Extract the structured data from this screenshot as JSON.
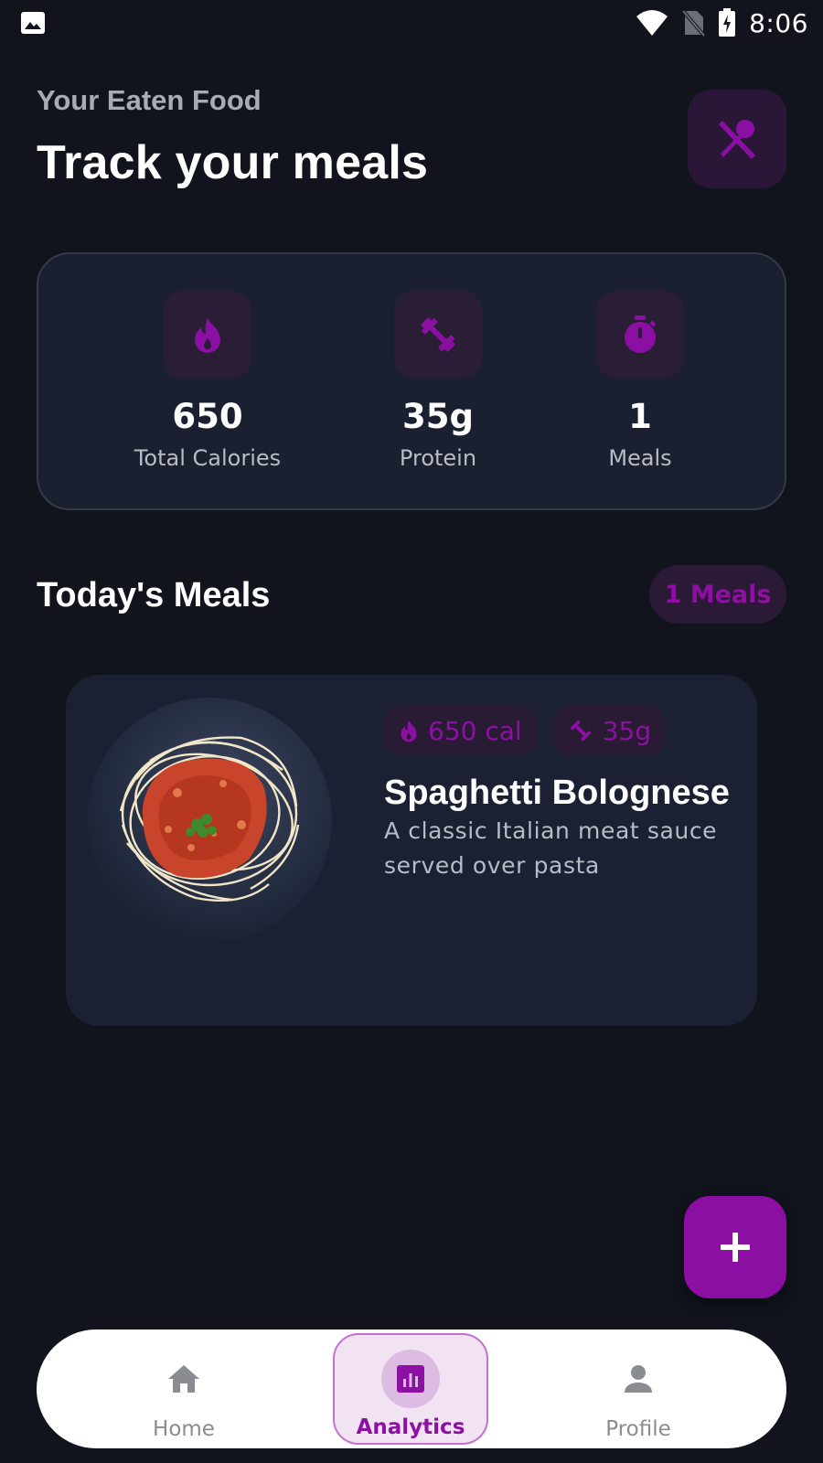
{
  "status_bar": {
    "time": "8:06",
    "left_icon": "image-icon",
    "icons": [
      "wifi-icon",
      "no-sim-icon",
      "battery-charging-icon"
    ]
  },
  "header": {
    "subtitle": "Your Eaten Food",
    "title": "Track your meals",
    "action_icon": "utensils-icon"
  },
  "stats": [
    {
      "icon": "flame-icon",
      "value": "650",
      "label": "Total Calories"
    },
    {
      "icon": "dumbbell-icon",
      "value": "35g",
      "label": "Protein"
    },
    {
      "icon": "timer-icon",
      "value": "1",
      "label": "Meals"
    }
  ],
  "section": {
    "title": "Today's Meals",
    "count_badge": "1 Meals"
  },
  "meals": [
    {
      "name": "Spaghetti Bolognese",
      "description": "A classic Italian meat sauce served over pasta",
      "calories_tag": "650 cal",
      "protein_tag": "35g"
    }
  ],
  "fab": {
    "icon": "plus-icon"
  },
  "nav": [
    {
      "label": "Home",
      "icon": "home-icon",
      "active": false
    },
    {
      "label": "Analytics",
      "icon": "analytics-icon",
      "active": true
    },
    {
      "label": "Profile",
      "icon": "person-icon",
      "active": false
    }
  ],
  "colors": {
    "background": "#11141d",
    "card": "#1b2031",
    "accent": "#8c0fa3",
    "accent_bg": "#2a1a35",
    "nav_active_bg": "#f2e3f3"
  }
}
